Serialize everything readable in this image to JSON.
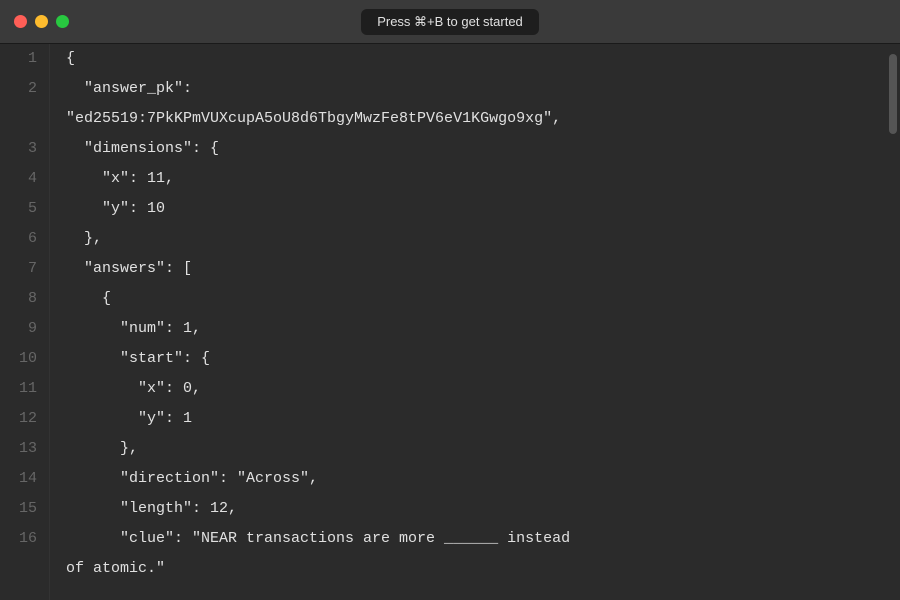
{
  "titleBar": {
    "title": "Press ⌘+B to get started",
    "trafficLights": [
      "red",
      "yellow",
      "green"
    ]
  },
  "editor": {
    "lines": [
      {
        "num": 1,
        "content": "{"
      },
      {
        "num": 2,
        "content": "  \"answer_pk\":"
      },
      {
        "num": "",
        "content": "\"ed25519:7PkKPmVUXcupA5oU8d6TbgyMwzFe8tPV6eV1KGwgo9xg\","
      },
      {
        "num": 3,
        "content": "  \"dimensions\": {"
      },
      {
        "num": 4,
        "content": "    \"x\": 11,"
      },
      {
        "num": 5,
        "content": "    \"y\": 10"
      },
      {
        "num": 6,
        "content": "  },"
      },
      {
        "num": 7,
        "content": "  \"answers\": ["
      },
      {
        "num": 8,
        "content": "    {"
      },
      {
        "num": 9,
        "content": "      \"num\": 1,"
      },
      {
        "num": 10,
        "content": "      \"start\": {"
      },
      {
        "num": 11,
        "content": "        \"x\": 0,"
      },
      {
        "num": 12,
        "content": "        \"y\": 1"
      },
      {
        "num": 13,
        "content": "      },"
      },
      {
        "num": 14,
        "content": "      \"direction\": \"Across\","
      },
      {
        "num": 15,
        "content": "      \"length\": 12,"
      },
      {
        "num": 16,
        "content": "      \"clue\": \"NEAR transactions are more ______ instead"
      },
      {
        "num": "",
        "content": "of atomic.\""
      }
    ]
  }
}
